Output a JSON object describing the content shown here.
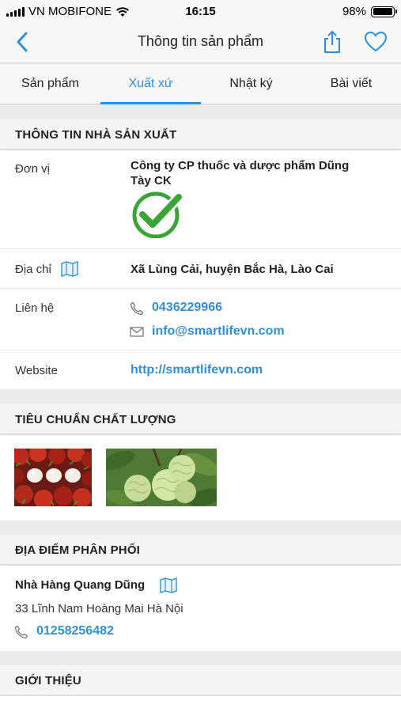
{
  "status_bar": {
    "carrier": "VN MOBIFONE",
    "time": "16:15",
    "battery": "98%",
    "battery_level": 0.98
  },
  "nav": {
    "title": "Thông tin sản phẩm"
  },
  "tabs": [
    {
      "label": "Sản phẩm"
    },
    {
      "label": "Xuất xứ"
    },
    {
      "label": "Nhật ký"
    },
    {
      "label": "Bài viết"
    }
  ],
  "manufacturer": {
    "header": "THÔNG TIN NHÀ SẢN XUẤT",
    "unit_label": "Đơn vị",
    "unit_line1": "Công ty CP thuốc và dược phẩm Dũng",
    "unit_line2": "Tày CK",
    "address_label": "Địa chỉ",
    "address": "Xã Lùng Cải, huyện Bắc Hà, Lào Cai",
    "contact_label": "Liên hệ",
    "phone": "0436229966",
    "email": "info@smartlifevn.com",
    "website_label": "Website",
    "website": "http://smartlifevn.com"
  },
  "quality": {
    "header": "TIÊU CHUẨN CHẤT LƯỢNG"
  },
  "distribution": {
    "header": "ĐỊA ĐIỂM PHÂN PHỐI",
    "name": "Nhà Hàng Quang Dũng",
    "address": "33 Lĩnh Nam Hoàng Mai Hà Nội",
    "phone": "01258256482"
  },
  "intro": {
    "header": "GIỚI THIỆU"
  },
  "colors": {
    "accent": "#2e8fdc",
    "verified_green": "#3aa536"
  }
}
